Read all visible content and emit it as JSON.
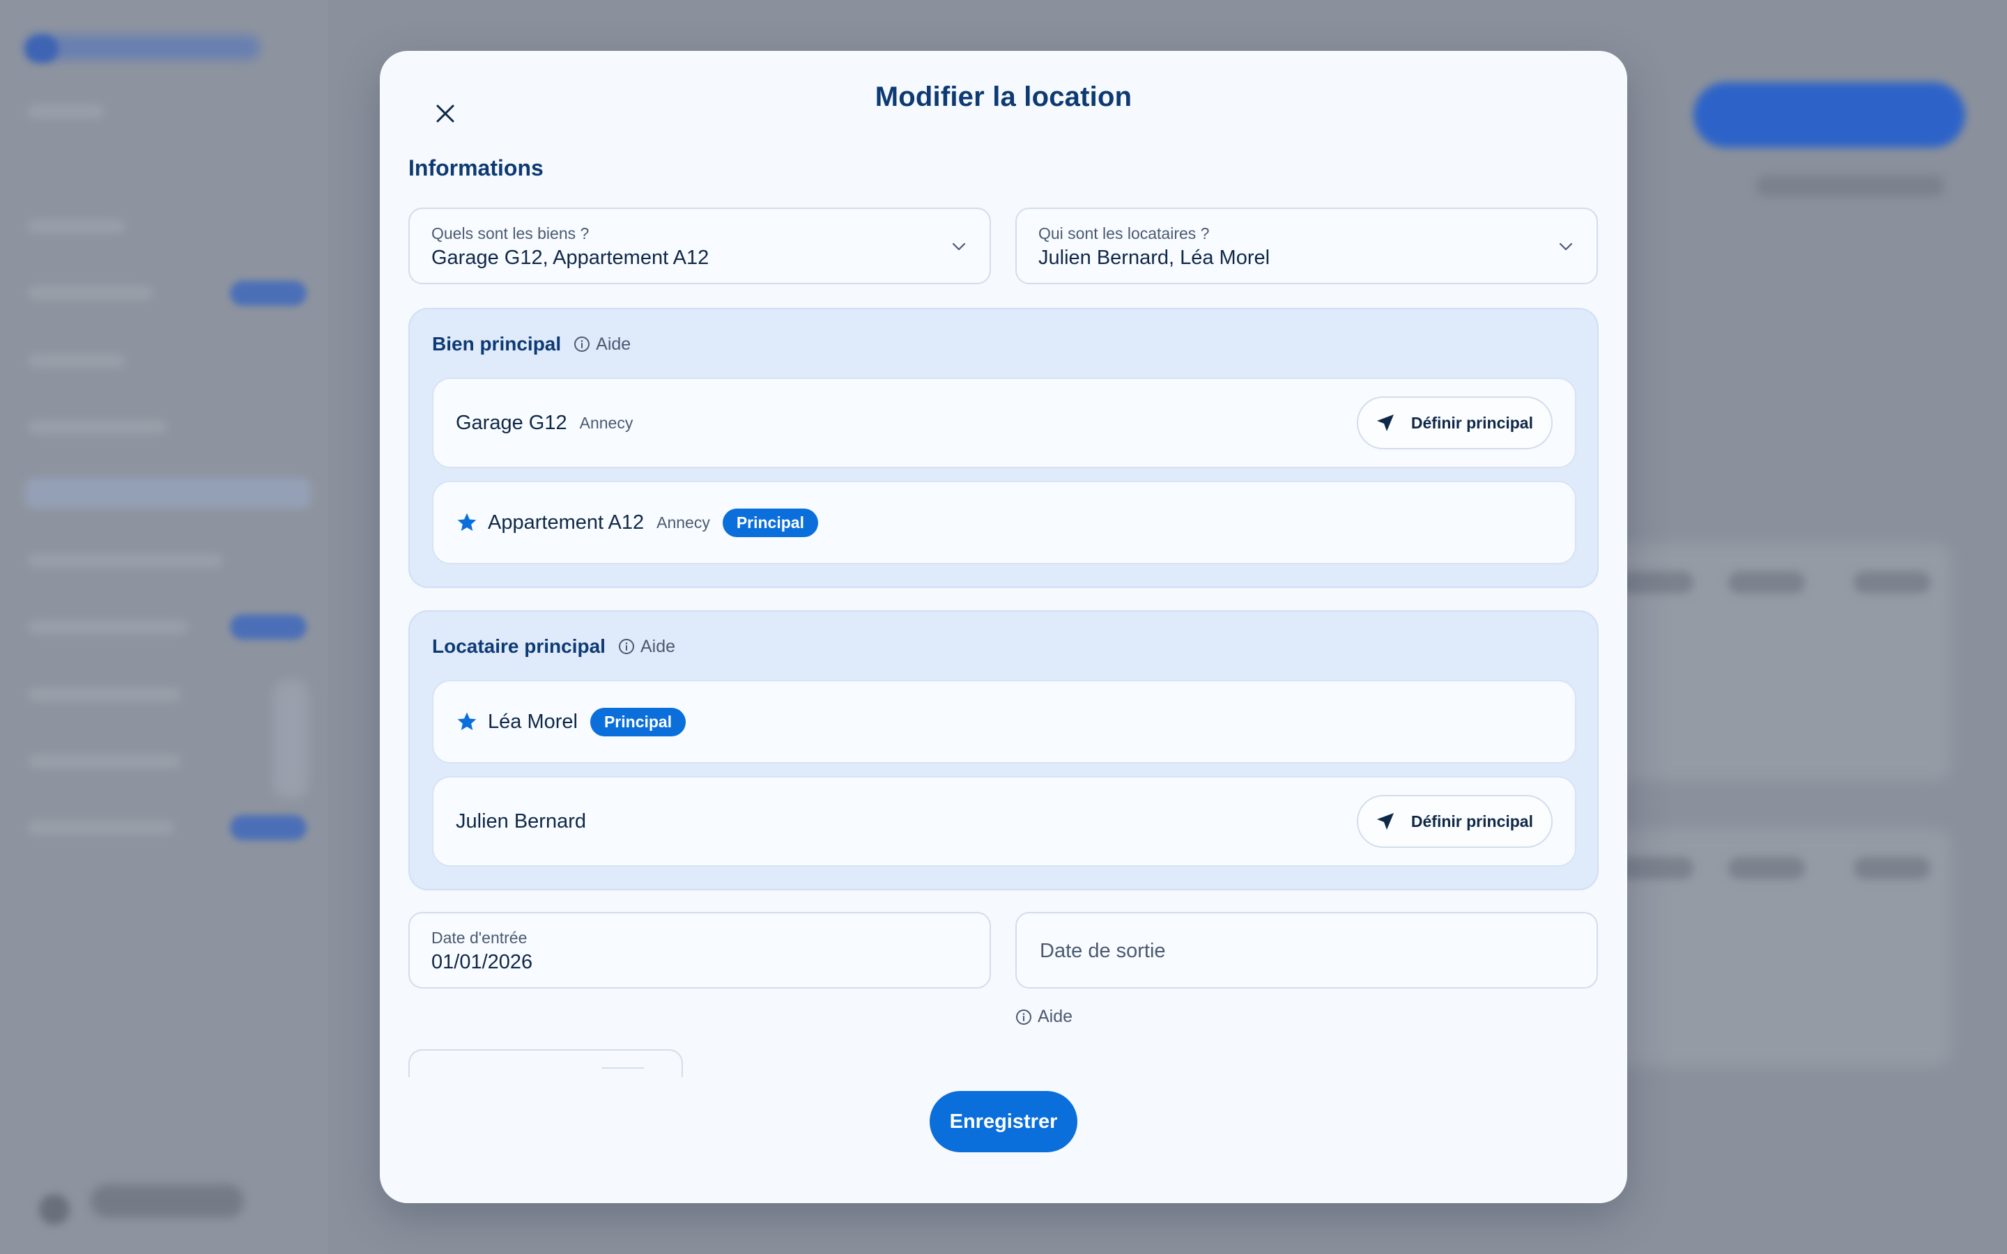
{
  "modal": {
    "title": "Modifier la location",
    "section_title": "Informations",
    "biens_select": {
      "label": "Quels sont les biens ?",
      "value": "Garage G12, Appartement A12"
    },
    "locataires_select": {
      "label": "Qui sont les locataires ?",
      "value": "Julien Bernard, Léa Morel"
    },
    "bien_principal": {
      "title": "Bien principal",
      "help": "Aide",
      "items": [
        {
          "name": "Garage G12",
          "city": "Annecy",
          "action": "Définir principal"
        },
        {
          "name": "Appartement A12",
          "city": "Annecy",
          "badge": "Principal"
        }
      ]
    },
    "locataire_principal": {
      "title": "Locataire principal",
      "help": "Aide",
      "items": [
        {
          "name": "Léa Morel",
          "badge": "Principal"
        },
        {
          "name": "Julien Bernard",
          "action": "Définir principal"
        }
      ]
    },
    "date_entree": {
      "label": "Date d'entrée",
      "value": "01/01/2026"
    },
    "date_sortie": {
      "placeholder": "Date de sortie"
    },
    "date_help": "Aide",
    "save_label": "Enregistrer"
  },
  "colors": {
    "primary": "#0a6edb",
    "heading": "#0d3a73",
    "group_bg": "#dfeafb",
    "modal_bg": "#f6f9fd"
  },
  "icons": {
    "close": "close-icon",
    "chevron": "chevron-down-icon",
    "info": "info-icon",
    "star": "star-icon",
    "navigation": "navigation-arrow-icon"
  }
}
